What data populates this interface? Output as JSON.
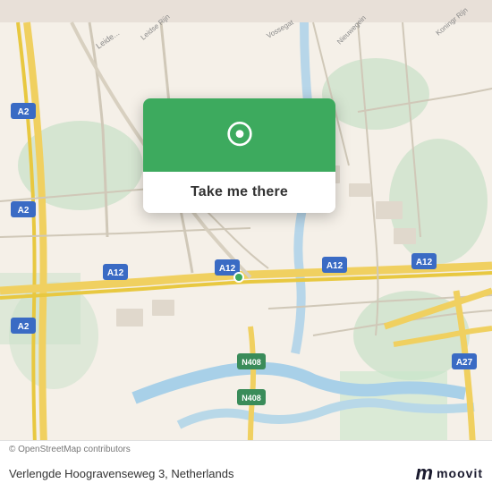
{
  "map": {
    "background_color": "#e8e0d8",
    "center": "Verlengde Hoogravenseweg 3, Netherlands"
  },
  "popup": {
    "button_label": "Take me there",
    "pin_color": "#3daa5e"
  },
  "bottom": {
    "copyright": "© OpenStreetMap contributors",
    "address": "Verlengde Hoogravenseweg 3, Netherlands",
    "logo_m": "m",
    "logo_text": "moovit"
  }
}
